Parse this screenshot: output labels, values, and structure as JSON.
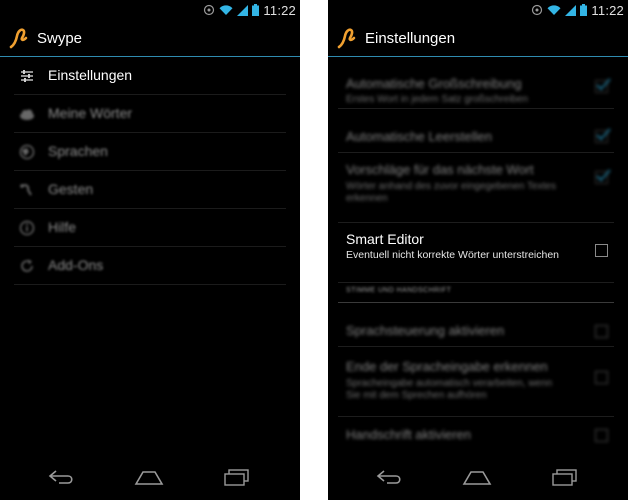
{
  "status": {
    "time": "11:22"
  },
  "left": {
    "app_title": "Swype",
    "menu": [
      {
        "label": "Einstellungen",
        "icon": "sliders-icon"
      },
      {
        "label": "Meine Wörter",
        "icon": "cloud-icon"
      },
      {
        "label": "Sprachen",
        "icon": "globe-icon"
      },
      {
        "label": "Gesten",
        "icon": "gesture-icon"
      },
      {
        "label": "Hilfe",
        "icon": "help-icon"
      },
      {
        "label": "Add-Ons",
        "icon": "refresh-icon"
      }
    ]
  },
  "right": {
    "title": "Einstellungen",
    "settings": [
      {
        "title": "Automatische Großschreibung",
        "sub": "Erstes Wort in jedem Satz großschreiben",
        "checked": true
      },
      {
        "title": "Automatische Leerstellen",
        "sub": "",
        "checked": true
      },
      {
        "title": "Vorschläge für das nächste Wort",
        "sub": "Wörter anhand des zuvor eingegebenen Textes erkennen",
        "checked": true
      },
      {
        "title": "Smart Editor",
        "sub": "Eventuell nicht korrekte Wörter unterstreichen",
        "checked": false
      },
      {
        "title": "Sprachsteuerung aktivieren",
        "sub": "",
        "checked": false
      },
      {
        "title": "Ende der Spracheingabe erkennen",
        "sub": "Spracheingabe automatisch verarbeiten, wenn Sie mit dem Sprechen aufhören",
        "checked": false
      },
      {
        "title": "Handschrift aktivieren",
        "sub": "",
        "checked": false
      }
    ],
    "section_header": "STIMME UND HANDSCHRIFT"
  },
  "colors": {
    "accent": "#2f8bb0",
    "logo": "#f0a030",
    "background": "#000000"
  }
}
